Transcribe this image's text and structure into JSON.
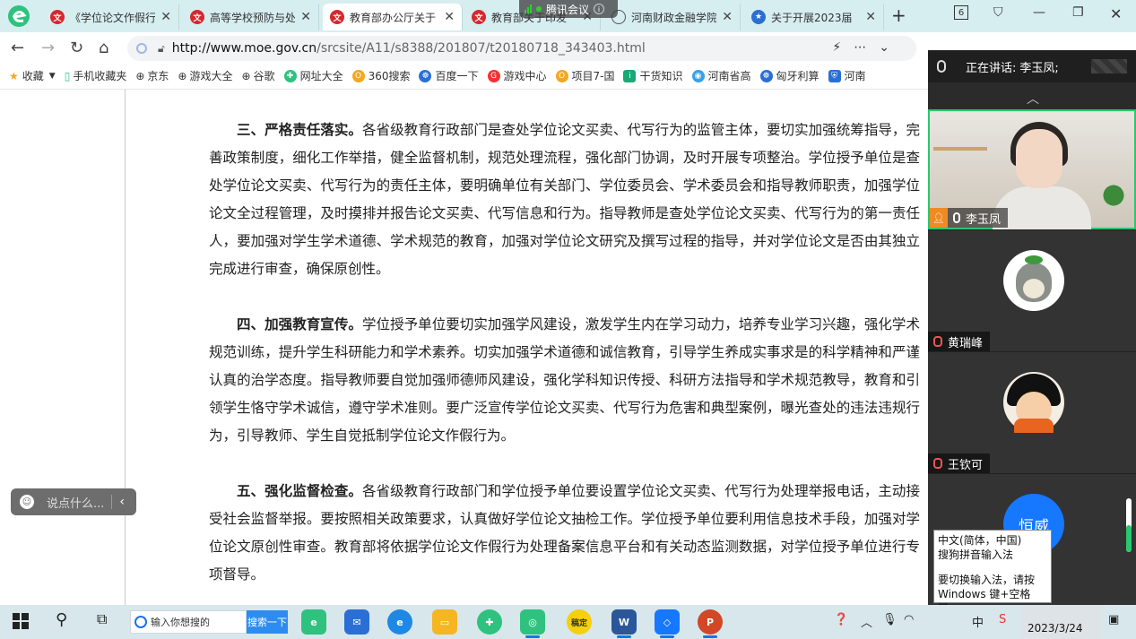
{
  "browser": {
    "tabs": [
      {
        "title": "《学位论文作假行",
        "icon": "red"
      },
      {
        "title": "高等学校预防与处",
        "icon": "red"
      },
      {
        "title": "教育部办公厅关于",
        "icon": "red",
        "active": true
      },
      {
        "title": "教育部关于印发",
        "icon": "red"
      },
      {
        "title": "河南财政金融学院",
        "icon": "globe"
      },
      {
        "title": "关于开展2023届",
        "icon": "star"
      }
    ],
    "tab_count": "6",
    "url_host": "http://www.moe.gov.cn",
    "url_path": "/srcsite/A11/s8388/201807/t20180718_343403.html",
    "bookmarks": [
      "收藏",
      "手机收藏夹",
      "京东",
      "游戏大全",
      "谷歌",
      "网址大全",
      "360搜索",
      "百度一下",
      "游戏中心",
      "项目7-国",
      "干货知识",
      "河南省高",
      "匈牙利算",
      "河南"
    ]
  },
  "meeting": {
    "app_name": "腾讯会议",
    "speaking_prefix": "正在讲话:",
    "speaking_name": "李玉凤;",
    "participants": [
      {
        "name": "李玉凤"
      },
      {
        "name": "黄瑞峰"
      },
      {
        "name": "王钦可"
      },
      {
        "name": "恒威"
      }
    ]
  },
  "article": {
    "paragraphs": [
      {
        "heading": "三、严格责任落实。",
        "body": "各省级教育行政部门是查处学位论文买卖、代写行为的监管主体，要切实加强统筹指导，完善政策制度，细化工作举措，健全监督机制，规范处理流程，强化部门协调，及时开展专项整治。学位授予单位是查处学位论文买卖、代写行为的责任主体，要明确单位有关部门、学位委员会、学术委员会和指导教师职责，加强学位论文全过程管理，及时摸排并报告论文买卖、代写信息和行为。指导教师是查处学位论文买卖、代写行为的第一责任人，要加强对学生学术道德、学术规范的教育，加强对学位论文研究及撰写过程的指导，并对学位论文是否由其独立完成进行审查，确保原创性。"
      },
      {
        "heading": "四、加强教育宣传。",
        "body": "学位授予单位要切实加强学风建设，激发学生内在学习动力，培养专业学习兴趣，强化学术规范训练，提升学生科研能力和学术素养。切实加强学术道德和诚信教育，引导学生养成实事求是的科学精神和严谨认真的治学态度。指导教师要自觉加强师德师风建设，强化学科知识传授、科研方法指导和学术规范教导，教育和引领学生恪守学术诚信，遵守学术准则。要广泛宣传学位论文买卖、代写行为危害和典型案例，曝光查处的违法违规行为，引导教师、学生自觉抵制学位论文作假行为。"
      },
      {
        "heading": "五、强化监督检查。",
        "body": "各省级教育行政部门和学位授予单位要设置学位论文买卖、代写行为处理举报电话，主动接受社会监督举报。要按照相关政策要求，认真做好学位论文抽检工作。学位授予单位要利用信息技术手段，加强对学位论文原创性审查。教育部将依据学位论文作假行为处理备案信息平台和有关动态监测数据，对学位授予单位进行专项督导。"
      }
    ]
  },
  "chat": {
    "placeholder": "说点什么..."
  },
  "ime": {
    "line1": "中文(简体，中国)",
    "line2": "搜狗拼音输入法",
    "line3": "要切换输入法，请按",
    "line4": "Windows 键+空格键。"
  },
  "taskbar": {
    "search_placeholder": "输入你想搜的",
    "search_button": "搜索一下",
    "apps": [
      "稿定",
      "W",
      "P"
    ],
    "ime_label": "中",
    "date": "2023/3/24"
  }
}
